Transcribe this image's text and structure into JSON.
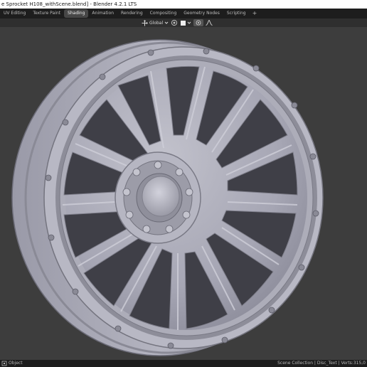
{
  "window": {
    "title": "e Sprocket H108_withScene.blend] - Blender 4.2.1 LTS"
  },
  "workspace_tabs": [
    {
      "label": "UV Editing",
      "active": false
    },
    {
      "label": "Texture Paint",
      "active": false
    },
    {
      "label": "Shading",
      "active": true
    },
    {
      "label": "Animation",
      "active": false
    },
    {
      "label": "Rendering",
      "active": false
    },
    {
      "label": "Compositing",
      "active": false
    },
    {
      "label": "Geometry Nodes",
      "active": false
    },
    {
      "label": "Scripting",
      "active": false
    }
  ],
  "add_tab_label": "+",
  "viewport_header": {
    "transform_orientation": "Global"
  },
  "statusbar": {
    "left_label": "Object",
    "right_text": "Scene Collection | Disc_Text | Verts:315,0"
  },
  "colors": {
    "viewport_bg": "#3d3d3d",
    "wheel_base": "#a6a6b4",
    "wheel_light": "#cfcfd9",
    "wheel_shadow": "#6c6c78",
    "topbar_bg": "#1d1d1d",
    "active_tab": "#474747"
  },
  "icons": [
    "object-mode-icon",
    "transform-pivot-icon",
    "chevron-down-icon",
    "snapping-icon",
    "shading-sphere-icon",
    "proportional-edit-icon",
    "falloff-curve-icon",
    "add-icon"
  ]
}
